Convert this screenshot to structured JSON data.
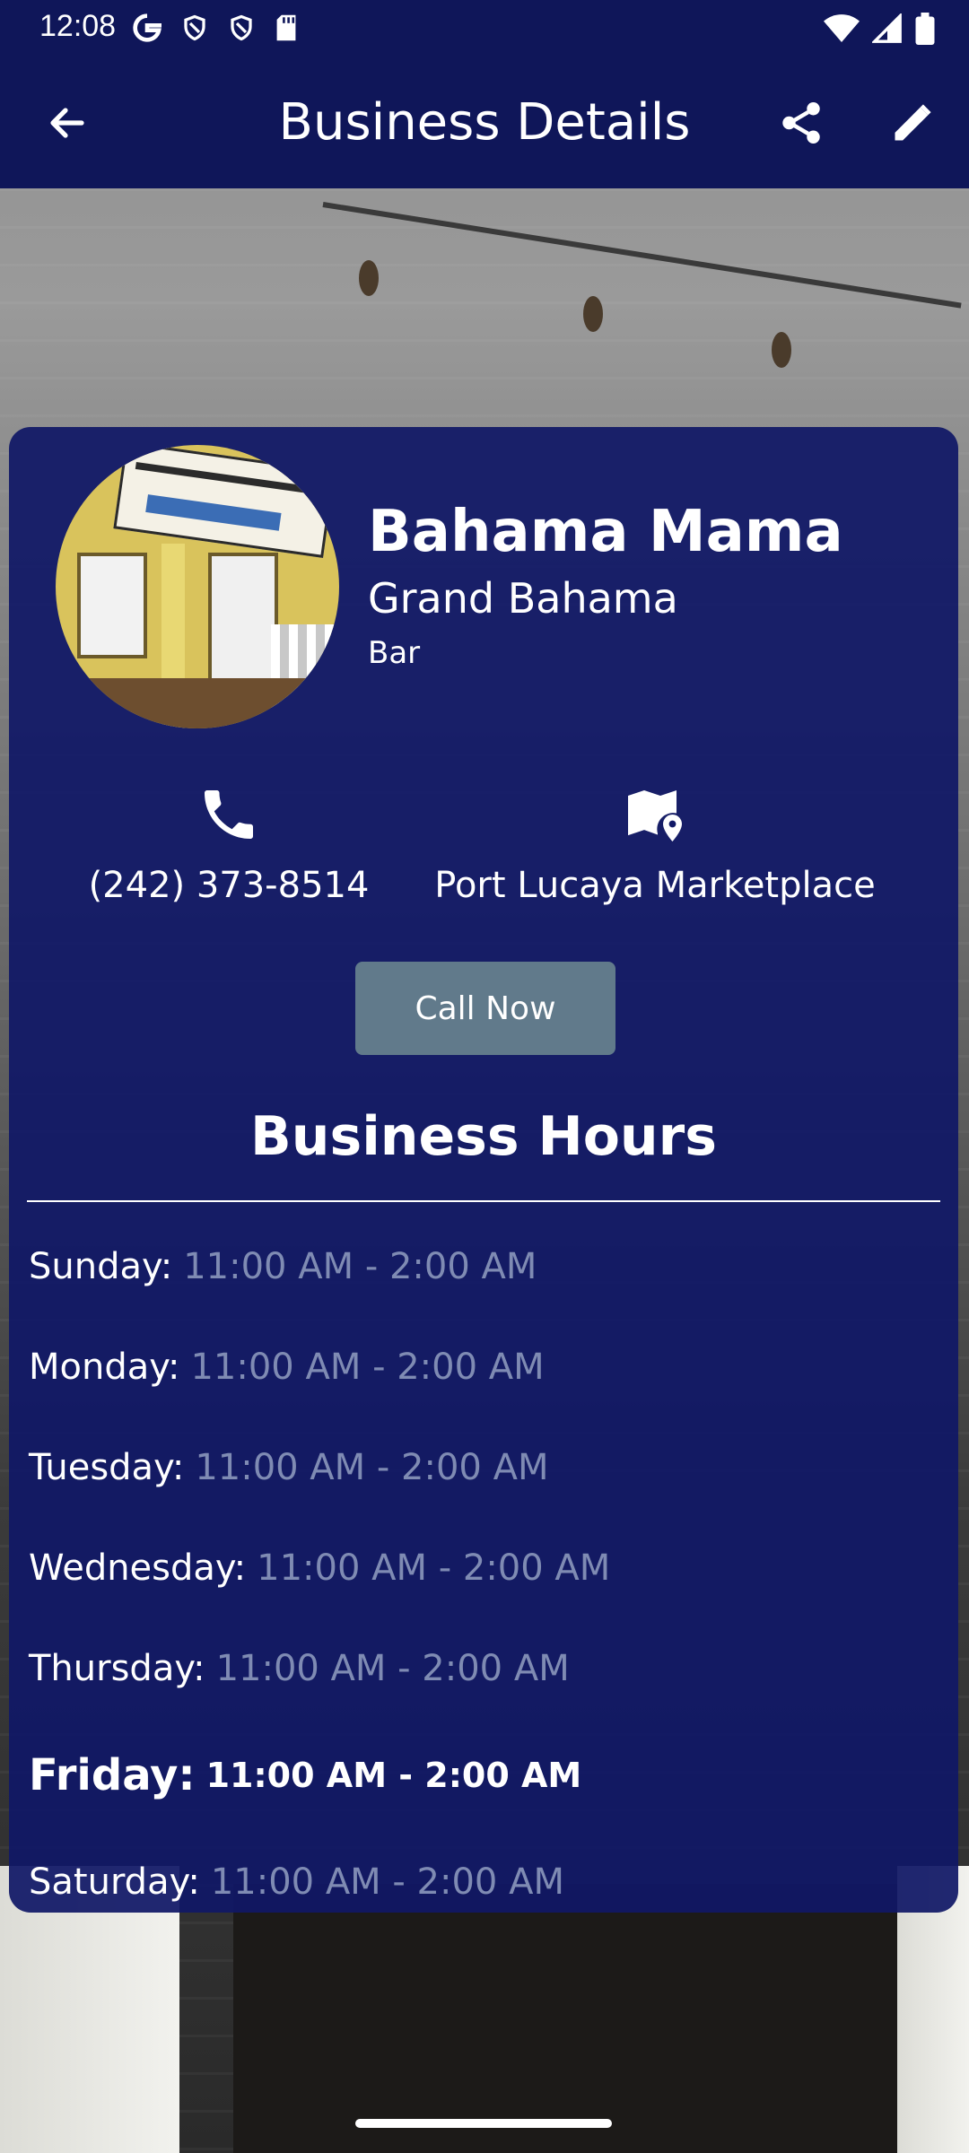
{
  "status_bar": {
    "time": "12:08"
  },
  "app_bar": {
    "title": "Business Details"
  },
  "business": {
    "name": "Bahama Mama",
    "region": "Grand Bahama",
    "category": "Bar",
    "phone": "(242) 373-8514",
    "location": "Port Lucaya Marketplace"
  },
  "actions": {
    "call_label": "Call Now"
  },
  "hours": {
    "title": "Business Hours",
    "days": [
      {
        "day": "Sunday:",
        "time": "11:00 AM - 2:00 AM"
      },
      {
        "day": "Monday:",
        "time": "11:00 AM - 2:00 AM"
      },
      {
        "day": "Tuesday:",
        "time": "11:00 AM - 2:00 AM"
      },
      {
        "day": "Wednesday:",
        "time": "11:00 AM - 2:00 AM"
      },
      {
        "day": "Thursday:",
        "time": "11:00 AM - 2:00 AM"
      },
      {
        "day": "Friday:",
        "time": "11:00 AM - 2:00 AM",
        "today": true
      },
      {
        "day": "Saturday:",
        "time": "11:00 AM - 2:00 AM"
      }
    ]
  },
  "colors": {
    "bar_background": "#0f1659",
    "card_background": "#101866",
    "button_background": "#617a8b",
    "muted_text": "#7f8bb3"
  },
  "icons": {
    "back": "arrow-left-icon",
    "share": "share-icon",
    "edit": "pencil-icon",
    "phone": "phone-icon",
    "map": "map-pin-icon"
  }
}
